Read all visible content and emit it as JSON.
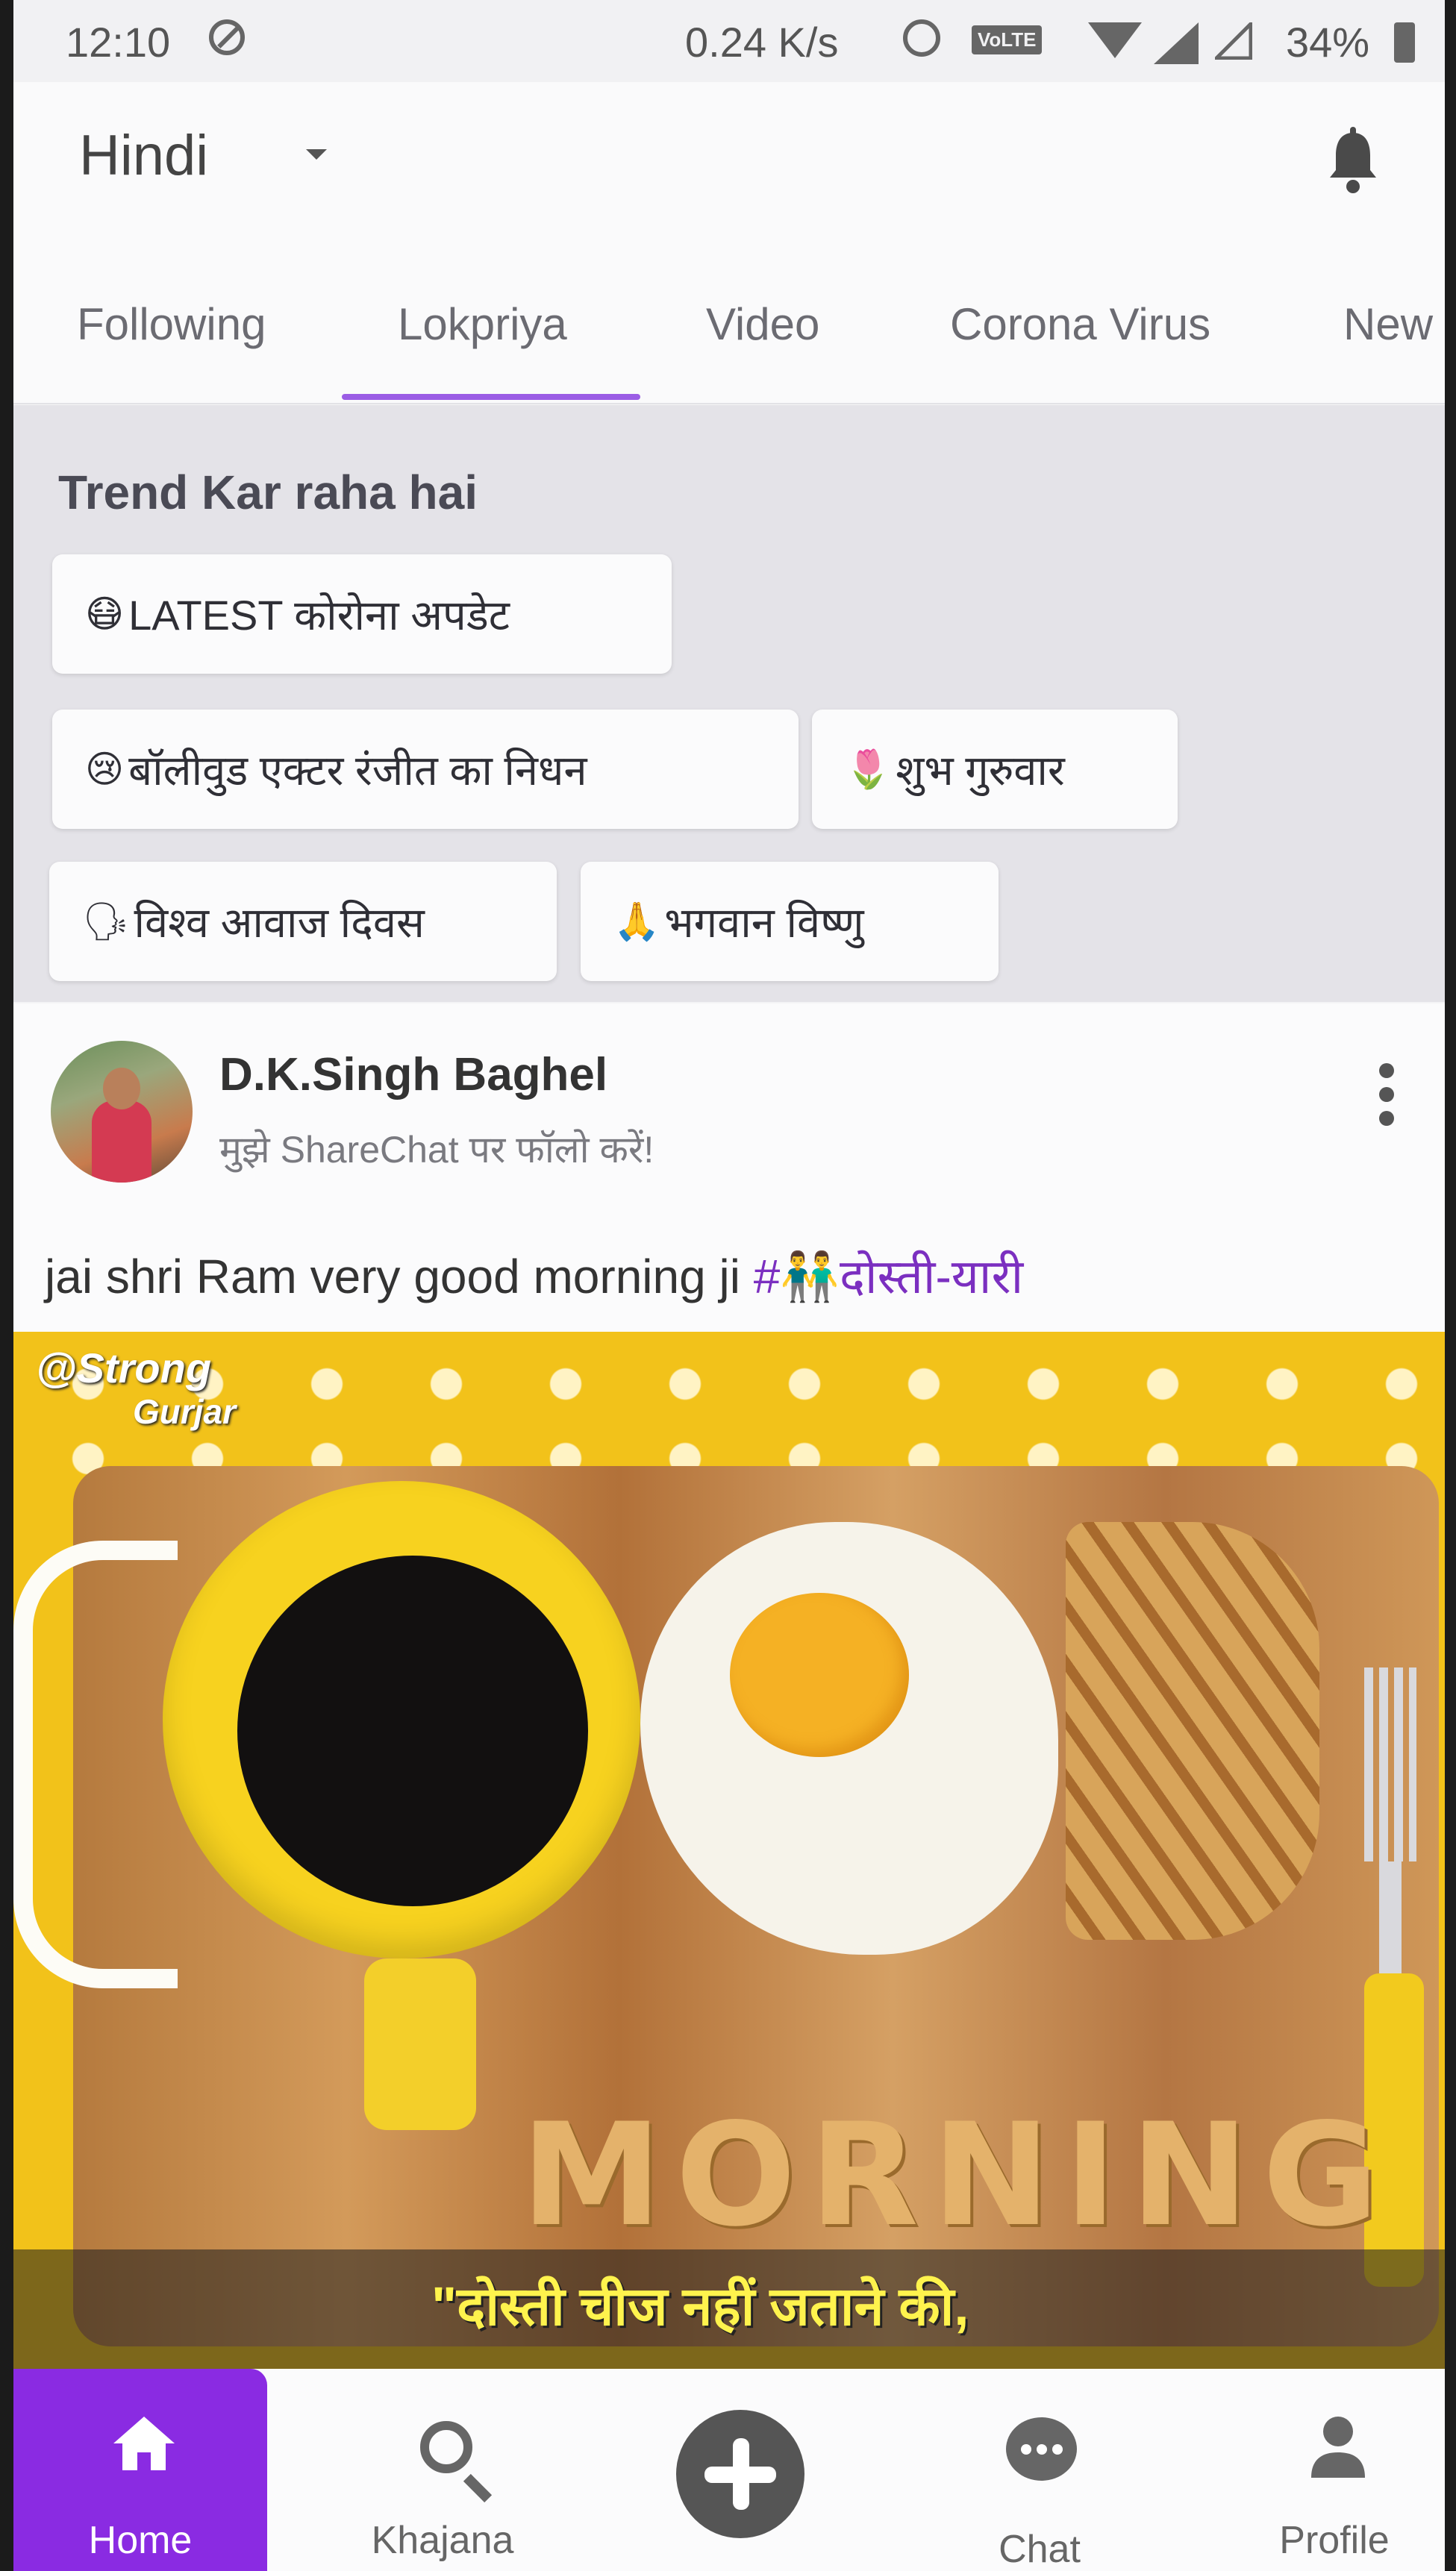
{
  "status_bar": {
    "time": "12:10",
    "network_speed": "0.24 K/s",
    "volte": "VoLTE",
    "battery": "34%"
  },
  "header": {
    "language": "Hindi",
    "bell_icon": "bell-icon"
  },
  "tabs": [
    {
      "label": "Following"
    },
    {
      "label": "Lokpriya",
      "active": true
    },
    {
      "label": "Video"
    },
    {
      "label": "Corona Virus"
    },
    {
      "label": "New"
    }
  ],
  "trending": {
    "title": "Trend Kar raha hai",
    "chips": [
      {
        "emoji": "😷",
        "label": "LATEST कोरोना अपडेट"
      },
      {
        "emoji": "😢",
        "label": "बॉलीवुड एक्टर रंजीत का निधन"
      },
      {
        "emoji": "🌷",
        "label": "शुभ गुरुवार"
      },
      {
        "emoji": "🗣",
        "label": "विश्व आवाज दिवस"
      },
      {
        "emoji": "🙏",
        "label": "भगवान विष्णु"
      }
    ]
  },
  "post": {
    "author": "D.K.Singh Baghel",
    "subline": "मुझे ShareChat पर फॉलो करें!",
    "caption_text": "jai shri Ram very good morning ji ",
    "caption_tag": "#👬दोस्ती-यारी",
    "image": {
      "watermark_line1": "@Strong",
      "watermark_line2": "Gurjar",
      "word": "MORNING",
      "overlay_text": "\"दोस्ती चीज नहीं जताने की,"
    }
  },
  "bottom_nav": {
    "home": "Home",
    "khajana": "Khajana",
    "chat": "Chat",
    "profile": "Profile"
  },
  "colors": {
    "accent": "#8a2be2",
    "tab_underline": "#9b5de5",
    "hashtag": "#7b2fc0"
  }
}
